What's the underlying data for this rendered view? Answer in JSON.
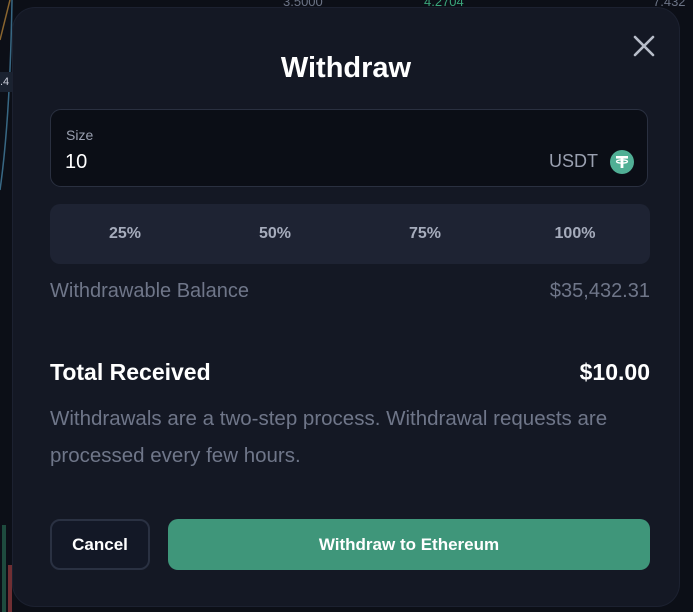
{
  "background": {
    "numbers": [
      "3.5000",
      "4.2704",
      "7.432"
    ],
    "tag": ".4"
  },
  "modal": {
    "title": "Withdraw",
    "close_icon": "close-icon"
  },
  "size_field": {
    "label": "Size",
    "value": "10",
    "currency": "USDT",
    "currency_icon": "tether-icon"
  },
  "percent_buttons": [
    "25%",
    "50%",
    "75%",
    "100%"
  ],
  "withdrawable_balance": {
    "label": "Withdrawable Balance",
    "value": "$35,432.31"
  },
  "total_received": {
    "label": "Total Received",
    "value": "$10.00"
  },
  "info_text": "Withdrawals are a two-step process. Withdrawal requests are processed every few hours.",
  "actions": {
    "cancel_label": "Cancel",
    "withdraw_label": "Withdraw to Ethereum"
  },
  "colors": {
    "accent": "#3f967a",
    "tether": "#50af95",
    "modal_bg": "#141824"
  }
}
